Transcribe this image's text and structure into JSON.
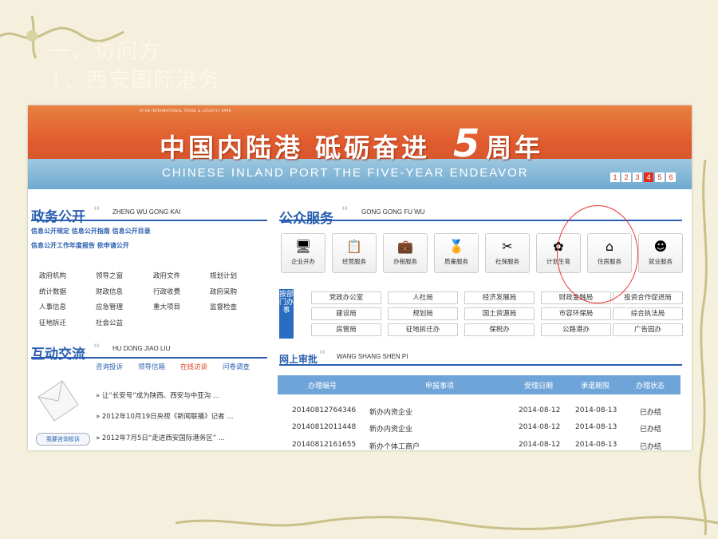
{
  "slide": {
    "title_line1": "一、访问方",
    "title_line2": "1、西安国际港务"
  },
  "banner": {
    "park_name": "XI'AN INTERNATIONAL TRADE & LOGISTIC PARK",
    "headline_cn": "中国内陆港 砥砺奋进",
    "five": "5",
    "headline_suffix": "周年",
    "headline_en": "CHINESE INLAND PORT THE FIVE-YEAR ENDEAVOR",
    "pages": [
      "1",
      "2",
      "3",
      "4",
      "5",
      "6"
    ],
    "active_page": "4"
  },
  "gov": {
    "title": "政务公开",
    "pinyin": "ZHENG WU GONG KAI",
    "links_row1": "信息公开规定  信息公开指南  信息公开目录",
    "links_row2": "信息公开工作年度报告  依申请公开",
    "items": [
      "政府机构",
      "领导之窗",
      "政府文件",
      "规划计划",
      "统计数据",
      "财政信息",
      "行政收费",
      "政府采购",
      "人事信息",
      "应急管理",
      "重大项目",
      "监督检查",
      "征地拆迁",
      "社会公益"
    ]
  },
  "interact": {
    "title": "互动交流",
    "pinyin": "HU DONG JIAO LIU",
    "tabs": [
      "咨询投诉",
      "领导信箱",
      "在线访谈",
      "问卷调查"
    ],
    "active_tab": "在线访谈",
    "news": [
      "» 让“长安号”成为陕西、西安与中亚沟 ...",
      "» 2012年10月19日央视《新闻联播》记者 ...",
      "» 2012年7月5日“走进西安国际港务区” ..."
    ],
    "consult_button": "我要咨询投诉"
  },
  "public": {
    "title": "公众服务",
    "pinyin": "GONG GONG FU WU",
    "services": [
      {
        "label": "企业开办",
        "icon": "monitor-icon"
      },
      {
        "label": "经营服务",
        "icon": "clipboard-icon"
      },
      {
        "label": "办税服务",
        "icon": "briefcase-icon"
      },
      {
        "label": "质量服务",
        "icon": "medal-icon"
      },
      {
        "label": "社保服务",
        "icon": "tools-icon"
      },
      {
        "label": "计划生育",
        "icon": "flower-icon"
      },
      {
        "label": "住房服务",
        "icon": "house-icon"
      },
      {
        "label": "就业服务",
        "icon": "people-icon"
      }
    ],
    "dept_label": "按部门办事",
    "departments": [
      "党政办公室",
      "人社局",
      "经济发展局",
      "财政金融局",
      "投资合作促进局",
      "建设局",
      "规划局",
      "国土资源局",
      "市容环保局",
      "综合执法局",
      "房管局",
      "征地拆迁办",
      "保税办",
      "公路港办",
      "广告园办"
    ]
  },
  "approval": {
    "title": "网上审批",
    "pinyin": "WANG SHANG SHEN PI",
    "headers": [
      "办理编号",
      "申报事项",
      "受理日期",
      "承诺期限",
      "办理状态"
    ],
    "rows": [
      [
        "20140812764346",
        "新办内资企业",
        "2014-08-12",
        "2014-08-13",
        "已办结"
      ],
      [
        "20140812011448",
        "新办内资企业",
        "2014-08-12",
        "2014-08-13",
        "已办结"
      ],
      [
        "20140812161655",
        "新办个体工商户",
        "2014-08-12",
        "2014-08-13",
        "已办结"
      ]
    ]
  },
  "colors": {
    "accent": "#2a5fb0",
    "banner": "#e05a2e",
    "annotation": "#e33333"
  }
}
